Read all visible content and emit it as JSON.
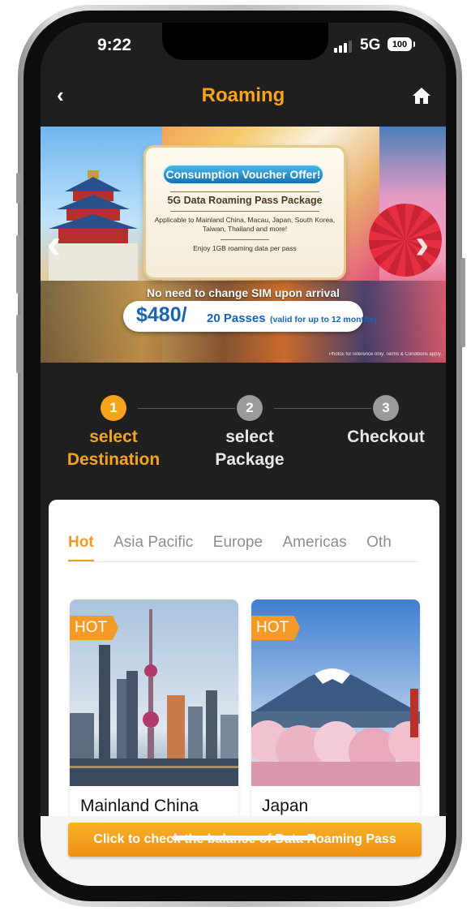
{
  "status_bar": {
    "time": "9:22",
    "network": "5G",
    "battery": "100"
  },
  "header": {
    "title": "Roaming",
    "back_icon": "chevron-left-icon",
    "home_icon": "home-icon"
  },
  "banner": {
    "voucher": "Consumption Voucher Offer!",
    "package": "5G Data Roaming Pass Package",
    "applicable": "Applicable to Mainland China, Macau, Japan, South Korea, Taiwan, Thailand and more!",
    "enjoy": "Enjoy 1GB roaming data per pass",
    "no_sim": "No need to change SIM upon arrival",
    "price": "$480/",
    "passes": "20 Passes",
    "validity": "(valid for up to 12 months)",
    "disclaimer": "Photos for reference only. Terms & Conditions apply."
  },
  "steps": [
    {
      "number": "1",
      "label": "select Destination",
      "active": true
    },
    {
      "number": "2",
      "label": "select Package",
      "active": false
    },
    {
      "number": "3",
      "label": "Checkout",
      "active": false
    }
  ],
  "tabs": [
    "Hot",
    "Asia Pacific",
    "Europe",
    "Americas",
    "Oth"
  ],
  "active_tab": "Hot",
  "destinations": [
    {
      "badge": "HOT",
      "name": "Mainland China"
    },
    {
      "badge": "HOT",
      "name": "Japan"
    }
  ],
  "footer": {
    "balance_button": "Click to check the balance of Data Roaming Pass"
  },
  "colors": {
    "accent": "#f7a31c",
    "dark_bg": "#1f1f1f",
    "price_blue": "#1864b5",
    "step_inactive": "#9a9a9a"
  }
}
